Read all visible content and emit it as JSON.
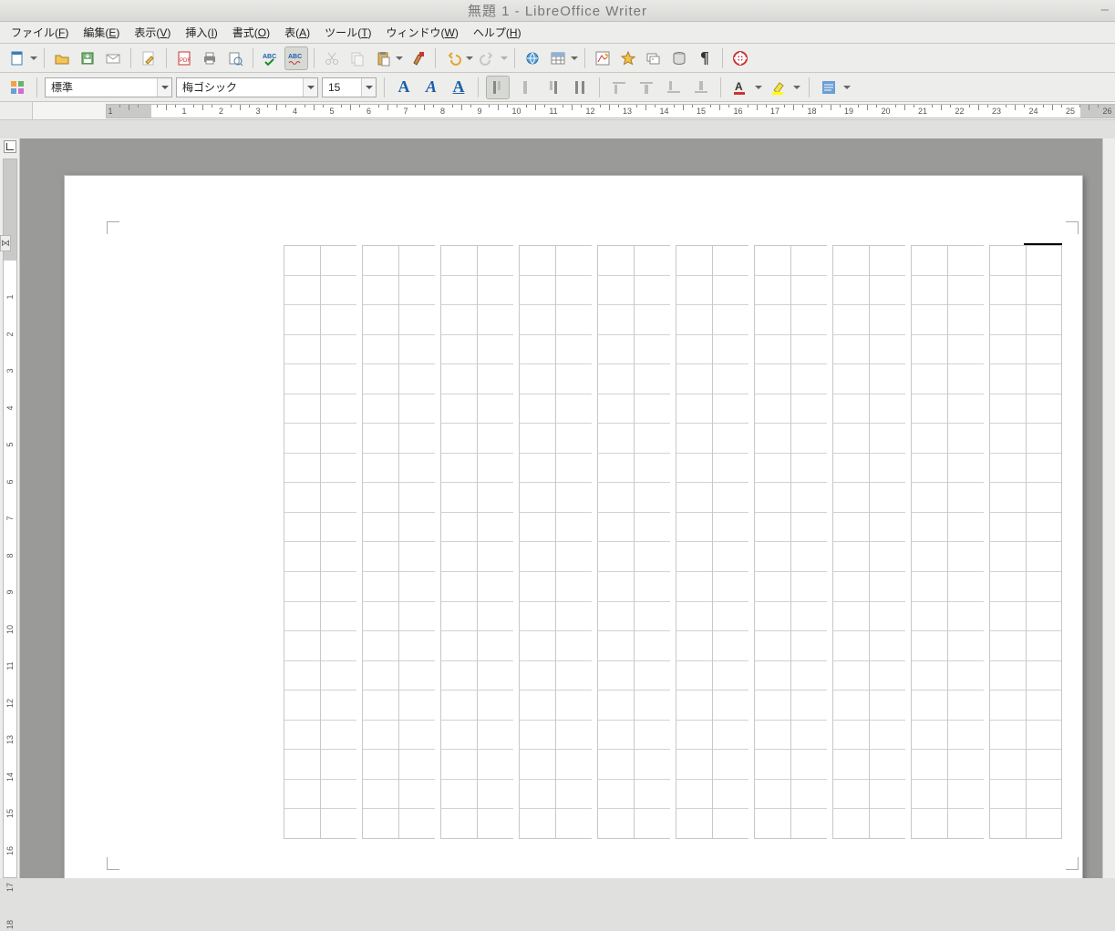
{
  "title": "無題 1 - LibreOffice Writer",
  "menus": {
    "file": {
      "label": "ファイル",
      "accel": "F"
    },
    "edit": {
      "label": "編集",
      "accel": "E"
    },
    "view": {
      "label": "表示",
      "accel": "V"
    },
    "insert": {
      "label": "挿入",
      "accel": "I"
    },
    "format": {
      "label": "書式",
      "accel": "O"
    },
    "table": {
      "label": "表",
      "accel": "A"
    },
    "tools": {
      "label": "ツール",
      "accel": "T"
    },
    "window": {
      "label": "ウィンドウ",
      "accel": "W"
    },
    "help": {
      "label": "ヘルプ",
      "accel": "H"
    }
  },
  "formatting": {
    "paragraph_style": "標準",
    "font_name": "梅ゴシック",
    "font_size": "15"
  },
  "ruler": {
    "h_start": -1,
    "h_end": 27,
    "v_start": -1,
    "v_end": 18
  },
  "page": {
    "grid": {
      "column_pairs": 10,
      "rows_per_column": 20
    }
  },
  "icons": {
    "new": "new-document-icon",
    "open": "open-icon",
    "save": "save-icon",
    "email": "email-icon",
    "edit_doc": "edit-doc-icon",
    "pdf": "export-pdf-icon",
    "print": "print-icon",
    "preview": "print-preview-icon",
    "spell": "spellcheck-icon",
    "autospell": "auto-spellcheck-icon",
    "cut": "cut-icon",
    "copy": "copy-icon",
    "paste": "paste-icon",
    "fmtbrush": "format-paintbrush-icon",
    "undo": "undo-icon",
    "redo": "redo-icon",
    "hyperlink": "hyperlink-icon",
    "tableins": "insert-table-icon",
    "draw": "show-draw-icon",
    "navigator": "navigator-icon",
    "gallery": "gallery-icon",
    "datasrc": "data-sources-icon",
    "nonprint": "nonprinting-chars-icon",
    "helpbtn": "help-icon",
    "bold": "bold-icon",
    "italic": "italic-icon",
    "underline": "underline-icon",
    "atl": "align-top-left-icon",
    "atc": "align-top-center-icon",
    "atr": "align-top-right-icon",
    "atj": "align-top-justify-icon",
    "abl": "align-bottom-left-icon",
    "abc": "align-bottom-center-icon",
    "abr": "align-bottom-right-icon",
    "abj": "align-bottom-justify-icon",
    "fontcolor": "font-color-icon",
    "highlight": "highlight-icon",
    "paracolor": "paragraph-bg-icon"
  }
}
